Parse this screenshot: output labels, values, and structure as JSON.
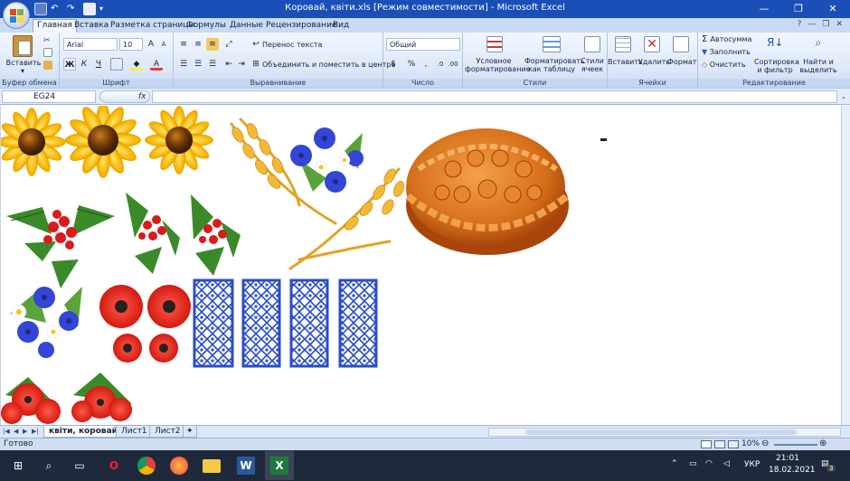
{
  "window": {
    "title": "Коровай, квіти.xls  [Режим совместимости] - Microsoft Excel",
    "min": "—",
    "restore": "❐",
    "close": "✕"
  },
  "tabs": [
    "Главная",
    "Вставка",
    "Разметка страницы",
    "Формулы",
    "Данные",
    "Рецензирование",
    "Вид"
  ],
  "ribbon": {
    "clipboard": {
      "paste": "Вставить",
      "label": "Буфер обмена"
    },
    "font": {
      "name": "Arial",
      "size": "10",
      "bold": "Ж",
      "italic": "К",
      "underline": "Ч",
      "label": "Шрифт"
    },
    "alignment": {
      "wrap": "Перенос текста",
      "merge": "Объединить и поместить в центре",
      "label": "Выравнивание"
    },
    "number": {
      "format": "Общий",
      "percent": "%",
      "label": "Число"
    },
    "styles": {
      "conditional": [
        "Условное",
        "форматирование"
      ],
      "as_table": [
        "Форматировать",
        "как таблицу"
      ],
      "cell_styles": [
        "Стили",
        "ячеек"
      ],
      "label": "Стили"
    },
    "cells": {
      "insert": "Вставить",
      "delete": "Удалить",
      "format": "Формат",
      "label": "Ячейки"
    },
    "editing": {
      "autosum": "Автосумма",
      "fill": "Заполнить",
      "clear": "Очистить",
      "sort": [
        "Сортировка",
        "и фильтр"
      ],
      "find": [
        "Найти и",
        "выделить"
      ],
      "label": "Редактирование"
    }
  },
  "formula_bar": {
    "name_box": "EG24",
    "fx": "fx",
    "value": ""
  },
  "sheet_tabs": [
    "квіти, коровай",
    "Лист1",
    "Лист2"
  ],
  "status": {
    "ready": "Готово",
    "zoom": "10%"
  },
  "taskbar": {
    "lang": "УКР",
    "time": "21:01",
    "date": "18.02.2021",
    "notifications": "3"
  },
  "colors": {
    "title": "#1a4fb8",
    "ribbon": "#dbe7f7",
    "excel_green": "#1d7a3e"
  },
  "icons": [
    "windows-icon",
    "search-icon",
    "task-view-icon",
    "opera-icon",
    "chrome-icon",
    "firefox-icon",
    "folder-icon",
    "word-icon",
    "excel-icon"
  ]
}
